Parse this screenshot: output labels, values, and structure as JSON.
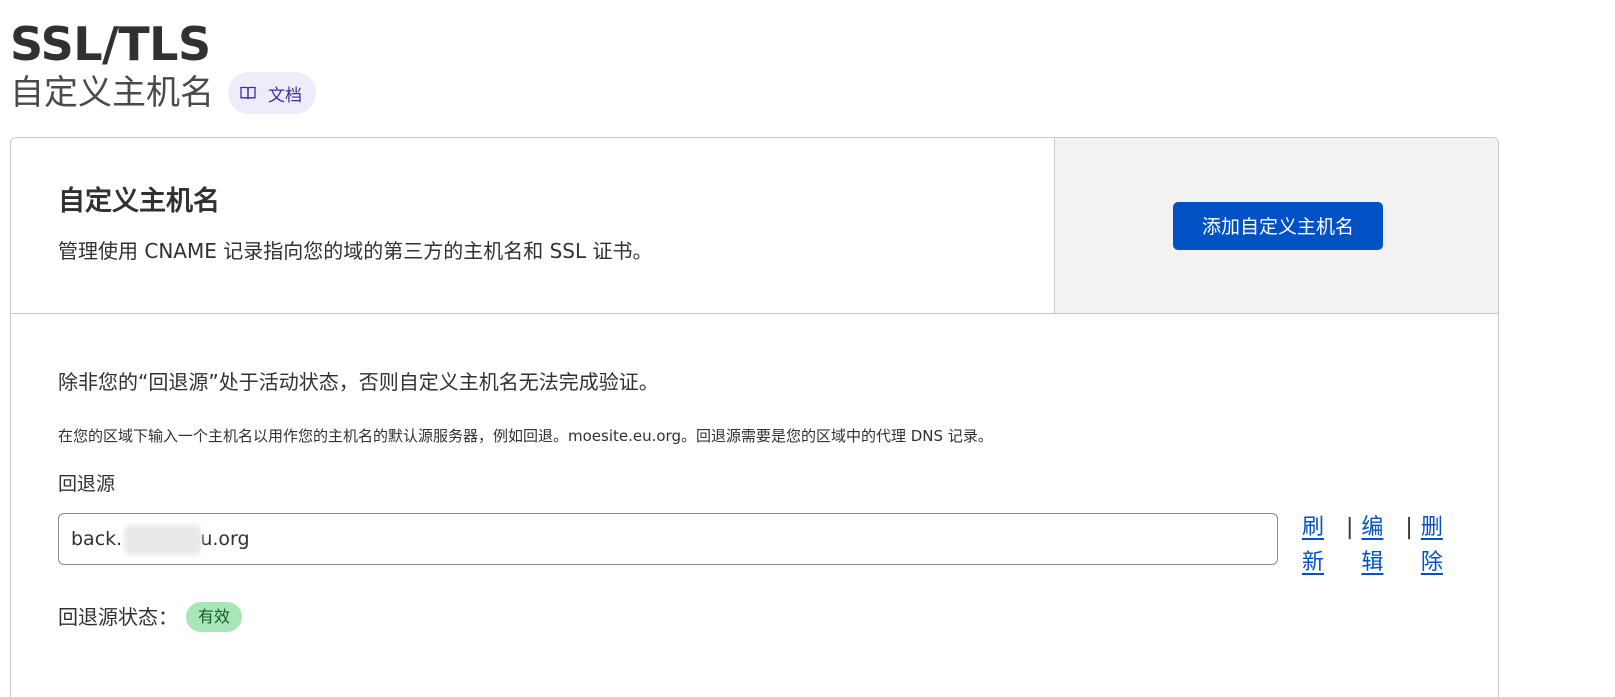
{
  "header": {
    "title": "SSL/TLS",
    "subtitle": "自定义主机名",
    "docs_label": "文档"
  },
  "card": {
    "section_title": "自定义主机名",
    "section_description": "管理使用 CNAME 记录指向您的域的第三方的主机名和 SSL 证书。",
    "add_button_label": "添加自定义主机名",
    "warning": "除非您的“回退源”处于活动状态，否则自定义主机名无法完成验证。",
    "help": "在您的区域下输入一个主机名以用作您的主机名的默认源服务器，例如回退。moesite.eu.org。回退源需要是您的区域中的代理 DNS 记录。",
    "fallback": {
      "label": "回退源",
      "value": "back.           eu.org",
      "actions": {
        "refresh": "刷新",
        "edit": "编辑",
        "delete": "删除",
        "separator": "|"
      },
      "status_label": "回退源状态：",
      "status_value": "有效"
    }
  },
  "colors": {
    "primary": "#0051c3",
    "badge_bg": "#a8e6b8",
    "docs_bg": "#eeecfb"
  }
}
